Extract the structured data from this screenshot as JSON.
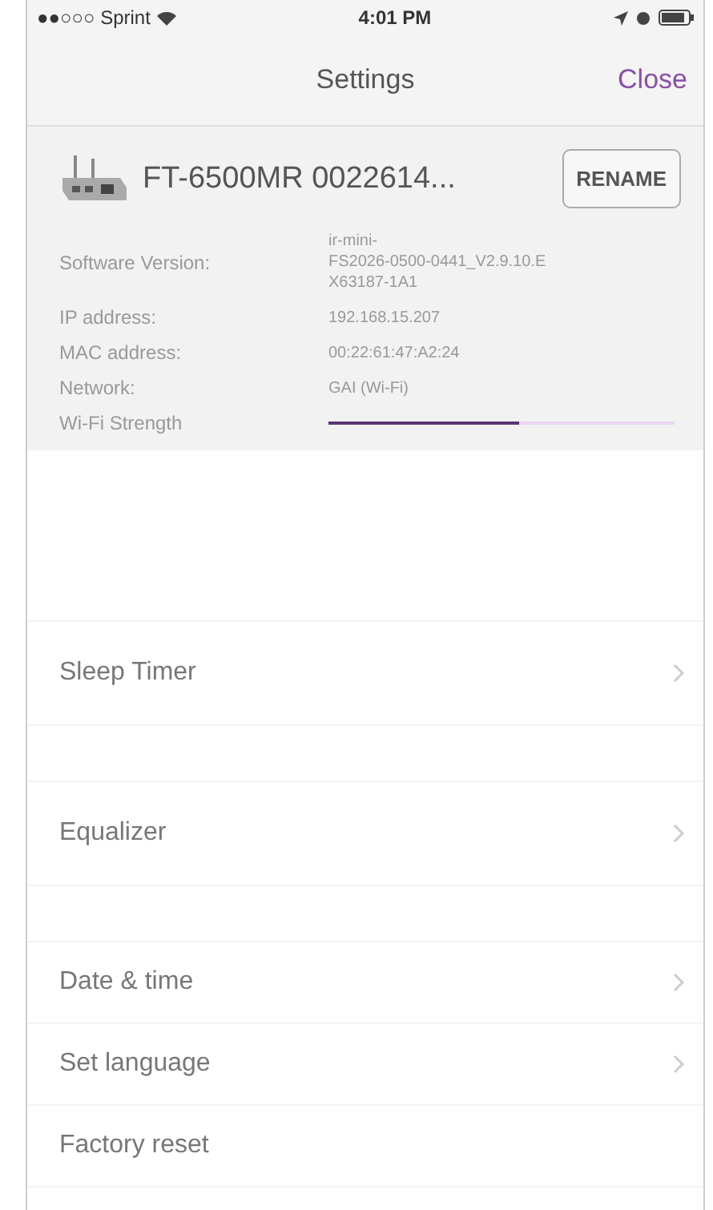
{
  "status_bar": {
    "carrier": "●●○○○ Sprint",
    "time": "4:01 PM"
  },
  "nav": {
    "title": "Settings",
    "close": "Close"
  },
  "device": {
    "name": "FT-6500MR 0022614...",
    "rename": "RENAME",
    "info": [
      {
        "label": "Software Version:",
        "lines": [
          "ir-mini-",
          "FS2026-0500-0441_V2.9.10.E",
          "X63187-1A1"
        ]
      },
      {
        "label": "IP address:",
        "lines": [
          "192.168.15.207"
        ]
      },
      {
        "label": "MAC address:",
        "lines": [
          "00:22:61:47:A2:24"
        ]
      },
      {
        "label": "Network:",
        "lines": [
          "GAI (Wi-Fi)"
        ]
      }
    ],
    "wifi": {
      "label": "Wi-Fi Strength",
      "level": 0.55
    }
  },
  "groups": [
    [
      {
        "label": "Sleep Timer",
        "chevron": true
      }
    ],
    [
      {
        "label": "Equalizer",
        "chevron": true
      }
    ],
    [
      {
        "label": "Date & time",
        "chevron": true
      },
      {
        "label": "Set language",
        "chevron": true
      },
      {
        "label": "Factory reset",
        "chevron": false
      }
    ]
  ]
}
